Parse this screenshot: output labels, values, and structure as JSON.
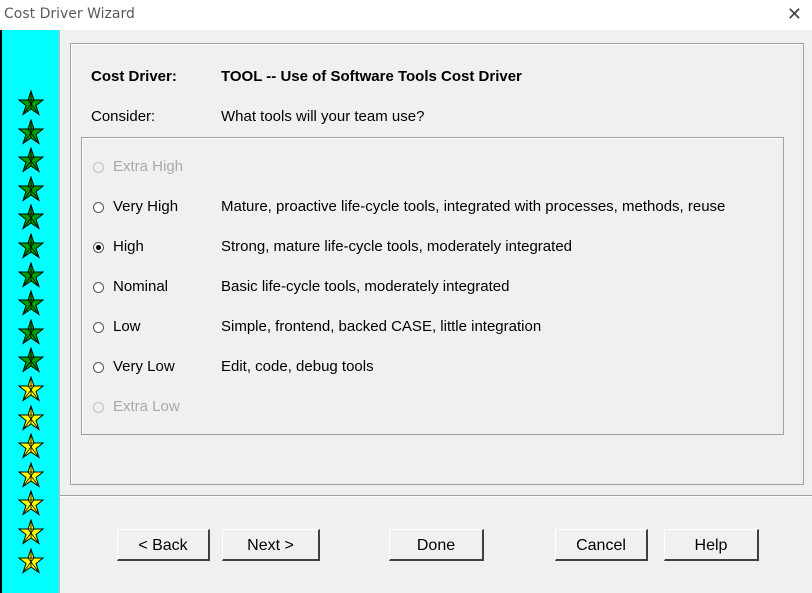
{
  "window": {
    "title": "Cost Driver Wizard"
  },
  "stars": {
    "green_count": 10,
    "yellow_count": 7,
    "green_color": "#00a000",
    "yellow_color": "#ffff00"
  },
  "header": {
    "cost_driver_label": "Cost Driver:",
    "cost_driver_value": "TOOL -- Use of Software Tools Cost Driver",
    "consider_label": "Consider:",
    "consider_value": "What tools will your team use?"
  },
  "ratings": [
    {
      "label": "Extra High",
      "description": "",
      "enabled": false,
      "checked": false
    },
    {
      "label": "Very High",
      "description": "Mature, proactive life-cycle tools, integrated with processes, methods, reuse",
      "enabled": true,
      "checked": false
    },
    {
      "label": "High",
      "description": "Strong, mature life-cycle tools, moderately integrated",
      "enabled": true,
      "checked": true
    },
    {
      "label": "Nominal",
      "description": "Basic life-cycle tools, moderately integrated",
      "enabled": true,
      "checked": false
    },
    {
      "label": "Low",
      "description": "Simple, frontend, backed CASE, little integration",
      "enabled": true,
      "checked": false
    },
    {
      "label": "Very Low",
      "description": "Edit, code, debug tools",
      "enabled": true,
      "checked": false
    },
    {
      "label": "Extra Low",
      "description": "",
      "enabled": false,
      "checked": false
    }
  ],
  "buttons": {
    "back": "< Back",
    "next": "Next >",
    "done": "Done",
    "cancel": "Cancel",
    "help": "Help"
  }
}
